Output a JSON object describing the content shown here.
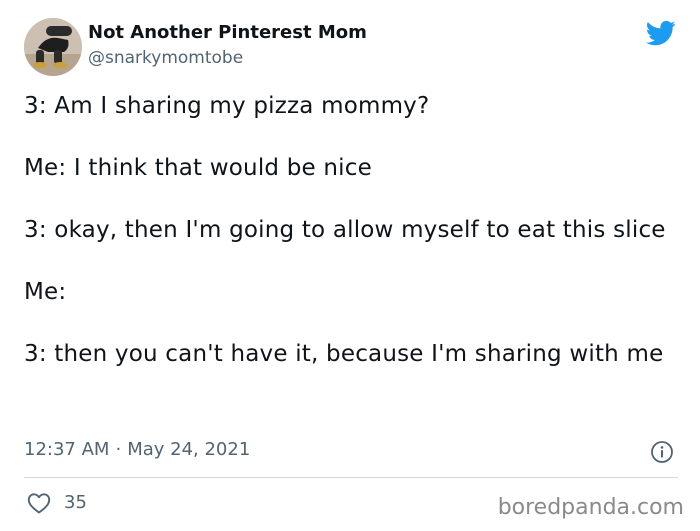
{
  "author": {
    "display_name": "Not Another Pinterest Mom",
    "handle": "@snarkymomtobe"
  },
  "tweet": {
    "paragraphs": [
      "3: Am I sharing my pizza mommy?",
      "Me: I think that would be nice",
      "3: okay, then I'm going to allow myself to eat this slice",
      "Me:",
      "3: then you can't have it, because I'm sharing with me"
    ],
    "time": "12:37 AM",
    "separator": "·",
    "date": "May 24, 2021",
    "like_count": "35"
  },
  "watermark": "boredpanda.com",
  "icons": {
    "brand": "twitter-bird-icon",
    "info": "info-icon",
    "like": "heart-icon"
  },
  "colors": {
    "twitter_blue": "#1d9bf0",
    "text_primary": "#0f1419",
    "text_secondary": "#536471",
    "divider": "#cfd9de"
  }
}
